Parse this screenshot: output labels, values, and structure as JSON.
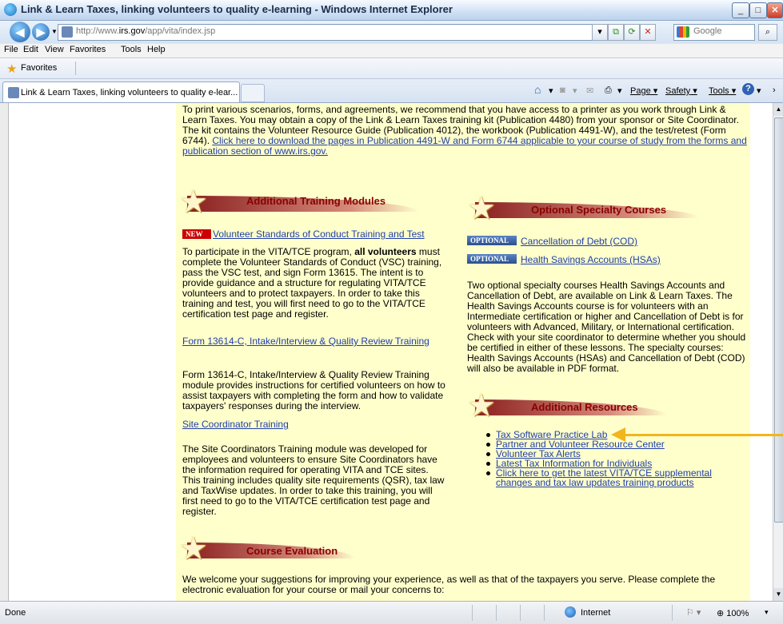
{
  "window": {
    "title": "Link & Learn Taxes, linking volunteers to quality e-learning - Windows Internet Explorer"
  },
  "address": {
    "url_prefix": "http://www.",
    "url_domain": "irs.gov",
    "url_path": "/app/vita/index.jsp"
  },
  "search": {
    "placeholder": "Google"
  },
  "menu": [
    "File",
    "Edit",
    "View",
    "Favorites",
    "Tools",
    "Help"
  ],
  "favorites": {
    "label": "Favorites"
  },
  "tab": {
    "title": "Link & Learn Taxes, linking volunteers to quality e-lear..."
  },
  "command_bar": {
    "page": "Page",
    "safety": "Safety",
    "tools": "Tools"
  },
  "content": {
    "intro": "To print various scenarios, forms, and agreements, we recommend that you have access to a printer as you work through Link & Learn Taxes. You may obtain a copy of the Link & Learn Taxes training kit (Publication 4480) from your sponsor or Site Coordinator. The kit contains the Volunteer Resource Guide (Publication 4012), the workbook (Publication 4491-W), and the test/retest (Form 6744).",
    "intro_link": "Click here to download the pages in Publication 4491-W and Form 6744 applicable to your course of study from the forms and publication section of www.irs.gov.",
    "left": {
      "heading": "Additional Training Modules",
      "new_badge": "NEW",
      "vsc_link": "Volunteer Standards of Conduct Training and Test",
      "vsc_text_a": "To participate in the VITA/TCE program, ",
      "vsc_text_bold": "all volunteers",
      "vsc_text_b": " must complete the Volunteer Standards of Conduct (VSC) training, pass the VSC test, and sign Form 13615. The intent is to provide guidance and a structure for regulating VITA/TCE volunteers and to protect taxpayers. In order to take this training and test, you will first need to go to the VITA/TCE certification test page and register.",
      "form_link": "Form 13614-C, Intake/Interview & Quality Review Training",
      "form_text": "Form 13614-C, Intake/Interview & Quality Review Training module provides instructions for certified volunteers on how to assist taxpayers with completing the form and how to validate taxpayers' responses during the interview.",
      "site_link": "Site Coordinator Training",
      "site_text": "The Site Coordinators Training module was developed for employees and volunteers to ensure Site Coordinators have the information required for operating VITA and TCE sites. This training includes quality site requirements (QSR), tax law and TaxWise updates. In order to take this training, you will first need to go to the VITA/TCE certification test page and register."
    },
    "right": {
      "heading": "Optional Specialty Courses",
      "optional_badge": "OPTIONAL",
      "cod_link": "Cancellation of Debt (COD)",
      "hsa_link": "Health Savings Accounts (HSAs)",
      "optional_text": "Two optional specialty courses Health Savings Accounts and Cancellation of Debt, are available on Link & Learn Taxes. The Health Savings Accounts course is for volunteers with an Intermediate certification or higher and Cancellation of Debt is for volunteers with Advanced, Military, or International certification. Check with your site coordinator to determine whether you should be certified in either of these lessons. The specialty courses: Health Savings Accounts (HSAs) and Cancellation of Debt (COD) will also be available in PDF format.",
      "resources_heading": "Additional Resources",
      "resources": [
        "Tax Software Practice Lab",
        "Partner and Volunteer Resource Center",
        "Volunteer Tax Alerts",
        "Latest Tax Information for Individuals",
        "Click here to get the latest VITA/TCE supplemental changes and tax law updates training products"
      ]
    },
    "evaluation": {
      "heading": "Course Evaluation",
      "text": "We welcome your suggestions for improving your experience, as well as that of the taxpayers you serve. Please complete the electronic evaluation for your course or mail your concerns to:"
    }
  },
  "status": {
    "left": "Done",
    "zone": "Internet",
    "zoom": "100%"
  }
}
